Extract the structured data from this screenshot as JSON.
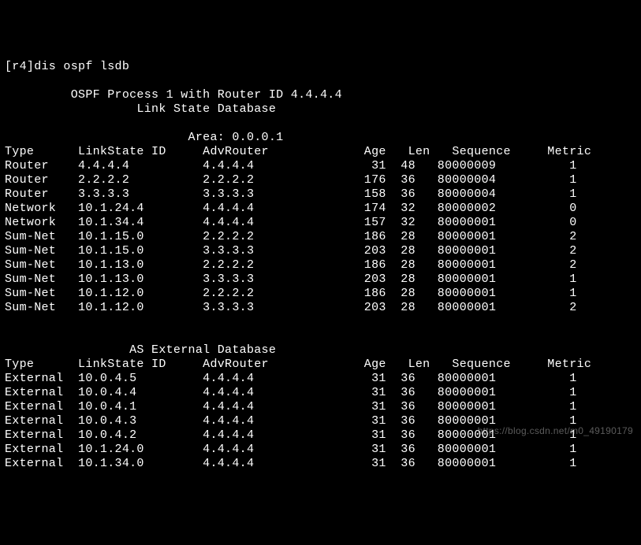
{
  "prompt": "[r4]dis ospf lsdb",
  "header1": "OSPF Process 1 with Router ID 4.4.4.4",
  "header2": "Link State Database",
  "area_label": "Area: 0.0.0.1",
  "columns": {
    "type": "Type",
    "linkstate": "LinkState ID",
    "advrouter": "AdvRouter",
    "age": "Age",
    "len": "Len",
    "sequence": "Sequence",
    "metric": "Metric"
  },
  "lsdb_rows": [
    {
      "type": "Router",
      "ls": "4.4.4.4",
      "adv": "4.4.4.4",
      "age": "31",
      "len": "48",
      "seq": "80000009",
      "metric": "1"
    },
    {
      "type": "Router",
      "ls": "2.2.2.2",
      "adv": "2.2.2.2",
      "age": "176",
      "len": "36",
      "seq": "80000004",
      "metric": "1"
    },
    {
      "type": "Router",
      "ls": "3.3.3.3",
      "adv": "3.3.3.3",
      "age": "158",
      "len": "36",
      "seq": "80000004",
      "metric": "1"
    },
    {
      "type": "Network",
      "ls": "10.1.24.4",
      "adv": "4.4.4.4",
      "age": "174",
      "len": "32",
      "seq": "80000002",
      "metric": "0"
    },
    {
      "type": "Network",
      "ls": "10.1.34.4",
      "adv": "4.4.4.4",
      "age": "157",
      "len": "32",
      "seq": "80000001",
      "metric": "0"
    },
    {
      "type": "Sum-Net",
      "ls": "10.1.15.0",
      "adv": "2.2.2.2",
      "age": "186",
      "len": "28",
      "seq": "80000001",
      "metric": "2"
    },
    {
      "type": "Sum-Net",
      "ls": "10.1.15.0",
      "adv": "3.3.3.3",
      "age": "203",
      "len": "28",
      "seq": "80000001",
      "metric": "2"
    },
    {
      "type": "Sum-Net",
      "ls": "10.1.13.0",
      "adv": "2.2.2.2",
      "age": "186",
      "len": "28",
      "seq": "80000001",
      "metric": "2"
    },
    {
      "type": "Sum-Net",
      "ls": "10.1.13.0",
      "adv": "3.3.3.3",
      "age": "203",
      "len": "28",
      "seq": "80000001",
      "metric": "1"
    },
    {
      "type": "Sum-Net",
      "ls": "10.1.12.0",
      "adv": "2.2.2.2",
      "age": "186",
      "len": "28",
      "seq": "80000001",
      "metric": "1"
    },
    {
      "type": "Sum-Net",
      "ls": "10.1.12.0",
      "adv": "3.3.3.3",
      "age": "203",
      "len": "28",
      "seq": "80000001",
      "metric": "2"
    }
  ],
  "ext_header": "AS External Database",
  "ext_rows": [
    {
      "type": "External",
      "ls": "10.0.4.5",
      "adv": "4.4.4.4",
      "age": "31",
      "len": "36",
      "seq": "80000001",
      "metric": "1"
    },
    {
      "type": "External",
      "ls": "10.0.4.4",
      "adv": "4.4.4.4",
      "age": "31",
      "len": "36",
      "seq": "80000001",
      "metric": "1"
    },
    {
      "type": "External",
      "ls": "10.0.4.1",
      "adv": "4.4.4.4",
      "age": "31",
      "len": "36",
      "seq": "80000001",
      "metric": "1"
    },
    {
      "type": "External",
      "ls": "10.0.4.3",
      "adv": "4.4.4.4",
      "age": "31",
      "len": "36",
      "seq": "80000001",
      "metric": "1"
    },
    {
      "type": "External",
      "ls": "10.0.4.2",
      "adv": "4.4.4.4",
      "age": "31",
      "len": "36",
      "seq": "80000001",
      "metric": "1"
    },
    {
      "type": "External",
      "ls": "10.1.24.0",
      "adv": "4.4.4.4",
      "age": "31",
      "len": "36",
      "seq": "80000001",
      "metric": "1"
    },
    {
      "type": "External",
      "ls": "10.1.34.0",
      "adv": "4.4.4.4",
      "age": "31",
      "len": "36",
      "seq": "80000001",
      "metric": "1"
    }
  ],
  "watermark": "https://blog.csdn.net/m0_49190179"
}
